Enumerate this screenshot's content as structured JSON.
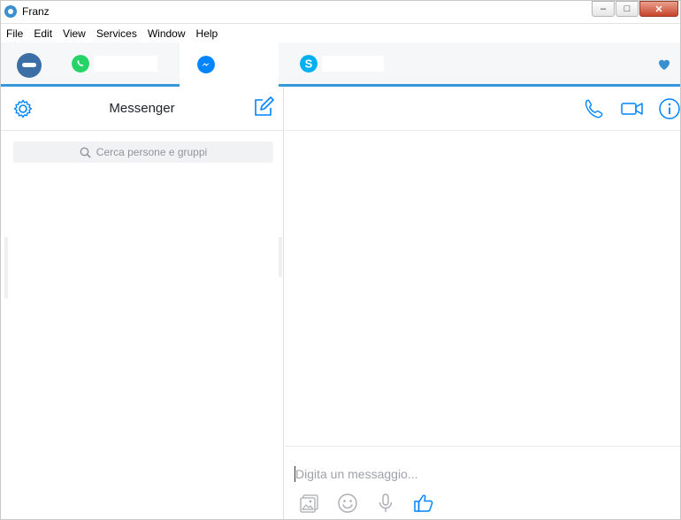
{
  "window": {
    "title": "Franz",
    "controls": {
      "minimize": "–",
      "maximize": "□",
      "close": "✕"
    }
  },
  "menu": [
    "File",
    "Edit",
    "View",
    "Services",
    "Window",
    "Help"
  ],
  "tabs": [
    {
      "service": "WhatsApp",
      "icon": "whatsapp-icon",
      "color": "#25d366",
      "label": "",
      "active": false
    },
    {
      "service": "Messenger",
      "icon": "messenger-icon",
      "color": "#0084ff",
      "label": "",
      "active": true
    },
    {
      "service": "Skype",
      "icon": "skype-icon",
      "color": "#00aff0",
      "label": "",
      "active": false
    }
  ],
  "colors": {
    "accent": "#3498db",
    "messenger_blue": "#0084ff",
    "icon_blue": "#3a8fd1"
  },
  "left_panel": {
    "title": "Messenger",
    "search_placeholder": "Cerca persone e gruppi",
    "icons": {
      "settings": "gear-icon",
      "compose": "compose-icon",
      "search": "search-icon"
    }
  },
  "right_panel": {
    "header_icons": [
      "phone-icon",
      "video-camera-icon",
      "info-icon"
    ],
    "composer": {
      "placeholder": "Digita un messaggio...",
      "icons": [
        "image-icon",
        "emoji-icon",
        "microphone-icon",
        "thumbs-up-icon"
      ]
    }
  }
}
